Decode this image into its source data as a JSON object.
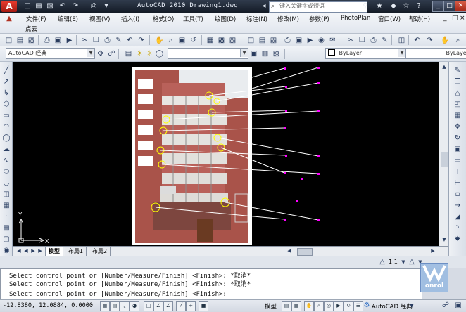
{
  "window": {
    "title": "AutoCAD 2010  Drawing1.dwg",
    "search_placeholder": "键入关键字或短语"
  },
  "menu": {
    "items": [
      "文件(F)",
      "编辑(E)",
      "视图(V)",
      "插入(I)",
      "格式(O)",
      "工具(T)",
      "绘图(D)",
      "标注(N)",
      "修改(M)",
      "参数(P)",
      "PhotoPlan",
      "窗口(W)",
      "帮助(H)"
    ],
    "second_row": "点云"
  },
  "toolbar2": {
    "workspace": "AutoCAD 经典",
    "linetype": "ByLayer",
    "lineweight": "ByLayer"
  },
  "canvas": {
    "ucs_x": "X",
    "ucs_y": "Y"
  },
  "layout_tabs": [
    "模型",
    "布局1",
    "布局2"
  ],
  "command": {
    "lines": [
      "Select control point or [Number/Measure/Finish] <Finish>: *取消*",
      "Select control point or [Number/Measure/Finish] <Finish>: *取消*"
    ],
    "prompt": "Select control point or [Number/Measure/Finish] <Finish>:"
  },
  "status": {
    "coordinates": "-12.8380, 12.0884, 0.0000",
    "model_label": "模型",
    "workspace": "AutoCAD 经典",
    "scale": "1:1",
    "watermark": "onrol"
  },
  "colors": {
    "canvas_bg": "#000000",
    "leader": "#ffffff",
    "marker": "#ff00ff",
    "target": "#ffff00"
  },
  "icons": [
    "app-logo-icon",
    "new-icon",
    "open-icon",
    "save-icon",
    "undo-icon",
    "redo-icon",
    "print-icon",
    "search-icon",
    "help-icon",
    "minimize-icon",
    "maximize-icon",
    "close-icon"
  ]
}
